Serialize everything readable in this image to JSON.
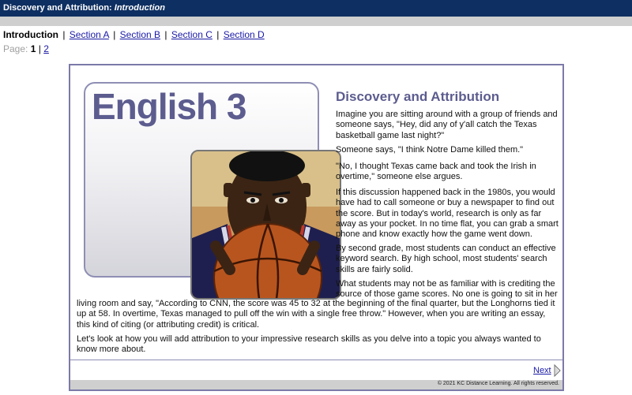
{
  "header": {
    "title_main": "Discovery and Attribution: ",
    "title_sub": "Introduction"
  },
  "nav": {
    "current": "Introduction",
    "links": [
      "Section A",
      "Section B",
      "Section C",
      "Section D"
    ],
    "separator": "|"
  },
  "pager": {
    "label": "Page:",
    "current": "1",
    "other": "2",
    "separator": "|"
  },
  "hero": {
    "title": "English 3"
  },
  "article": {
    "title": "Discovery and Attribution",
    "paragraphs": [
      "Imagine you are sitting around with a group of friends and someone says, \"Hey, did any of y'all catch the Texas basketball game last night?\"",
      "Someone says, \"I think Notre Dame killed them.\"",
      "\"No, I thought Texas came back and took the Irish in overtime,\" someone else argues.",
      "If this discussion happened back in the 1980s, you would have had to call someone or buy a newspaper to find out the score. But in today's world, research is only as far away as your pocket. In no time flat, you can grab a smart phone and know exactly how the game went down.",
      "By second grade, most students can conduct an effective keyword search. By high school, most students' search skills are fairly solid.",
      "What students may not be as familiar with is crediting the source of those game scores. No one is going to sit in her",
      "living room and say, \"According to CNN, the score was 45 to 32 at the beginning of the final quarter, but the Longhorns tied it up at 58. In overtime, Texas managed to pull off the win with a single free throw.\" However, when you are writing an essay, this kind of citing (or attributing credit) is critical.",
      "Let's look at how you will add attribution to your impressive research skills as you delve into a topic you always wanted to know more about."
    ]
  },
  "footer": {
    "next_label": "Next",
    "copyright": "© 2021 KC Distance Learning. All rights reserved."
  },
  "colors": {
    "title_bar": "#0e2f61",
    "accent": "#5c5c8f",
    "link": "#1a1aa6",
    "frame_border": "#7b7aa8"
  }
}
